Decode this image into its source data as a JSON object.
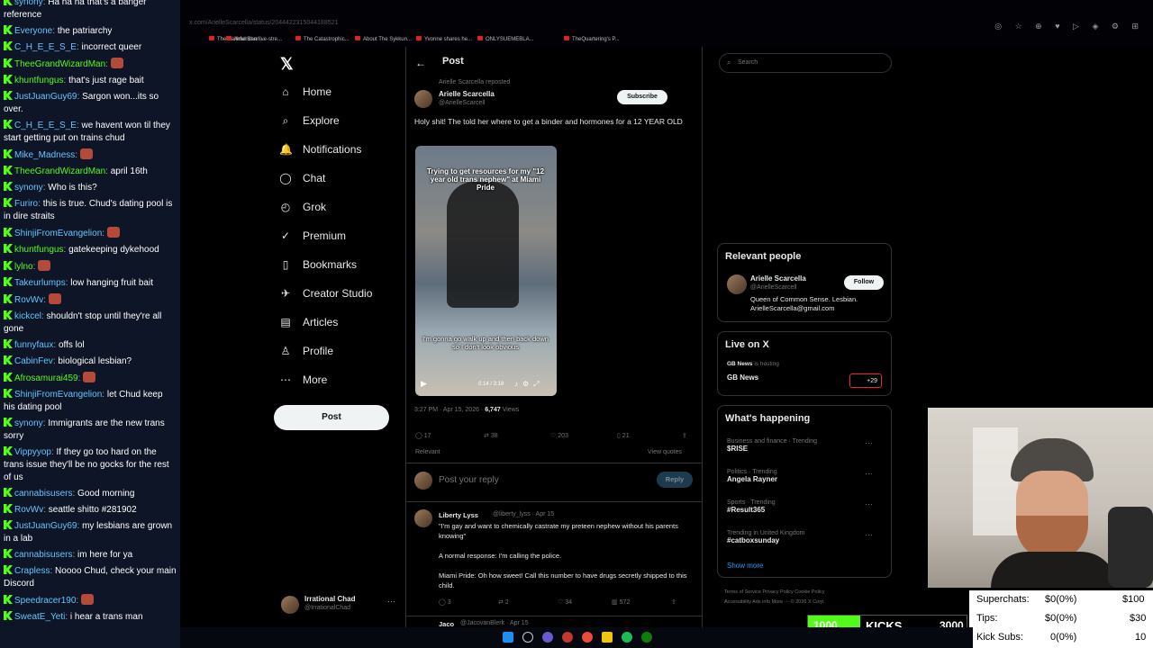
{
  "chat": [
    {
      "user": "synony",
      "text": "Ha ha ha that's a banger reference",
      "c": "c2"
    },
    {
      "user": "Everyone",
      "text": "the patriarchy",
      "c": "c2"
    },
    {
      "user": "C_H_E_E_S_E",
      "text": "incorrect queer",
      "c": "c2"
    },
    {
      "user": "TheeGrandWizardMan",
      "text": "",
      "c": "",
      "emote": true
    },
    {
      "user": "khuntfungus",
      "text": "that's just rage bait",
      "c": ""
    },
    {
      "user": "JustJuanGuy69",
      "text": "Sargon won...its so over.",
      "c": "c2"
    },
    {
      "user": "C_H_E_E_S_E",
      "text": "we havent won til they start getting put on trains chud",
      "c": "c2"
    },
    {
      "user": "Mike_Madness",
      "text": "",
      "c": "c2",
      "emote": true
    },
    {
      "user": "TheeGrandWizardMan",
      "text": "april 16th",
      "c": ""
    },
    {
      "user": "synony",
      "text": "Who is this?",
      "c": "c2"
    },
    {
      "user": "Furiro",
      "text": "this is true. Chud's dating pool is in dire straits",
      "c": "c2"
    },
    {
      "user": "ShinjiFromEvangelion",
      "text": "",
      "c": "c2",
      "emote": true
    },
    {
      "user": "khuntfungus",
      "text": "gatekeeping dykehood",
      "c": ""
    },
    {
      "user": "lylno",
      "text": "",
      "c": "",
      "emote": true
    },
    {
      "user": "Takeurlumps",
      "text": "low hanging fruit bait",
      "c": "c2"
    },
    {
      "user": "RovWv",
      "text": "",
      "c": "c2",
      "emote": true
    },
    {
      "user": "kickcel",
      "text": "shouldn't stop until they're all gone",
      "c": "c2"
    },
    {
      "user": "funnyfaux",
      "text": "offs lol",
      "c": "c2"
    },
    {
      "user": "CabinFev",
      "text": "biological lesbian?",
      "c": "c2"
    },
    {
      "user": "Afrosamurai459",
      "text": "",
      "c": "",
      "emote": true
    },
    {
      "user": "ShinjiFromEvangelion",
      "text": "let Chud keep his dating pool",
      "c": "c2"
    },
    {
      "user": "synony",
      "text": "Immigrants are the new trans sorry",
      "c": "c2"
    },
    {
      "user": "Vippyyop",
      "text": "If they go too hard on the trans issue they'll be no gocks for the rest of us",
      "c": "c2"
    },
    {
      "user": "cannabisusers",
      "text": "Good morning",
      "c": "c2"
    },
    {
      "user": "RovWv",
      "text": "seattle shitto #281902",
      "c": "c2"
    },
    {
      "user": "JustJuanGuy69",
      "text": "my lesbians are grown in a lab",
      "c": "c2"
    },
    {
      "user": "cannabisusers",
      "text": "im here for ya",
      "c": "c2"
    },
    {
      "user": "Crapless",
      "text": "Noooo Chud, check your main Discord",
      "c": "c2"
    },
    {
      "user": "Speedracer190",
      "text": "",
      "c": "c2",
      "emote": true
    },
    {
      "user": "SweatE_Yeti",
      "text": "i hear a trans man",
      "c": "c2"
    }
  ],
  "browser": {
    "url": "x.com/ArielleScarcella/status/2044422315044188521",
    "bookmarks": [
      "The Faithful Sheri...",
      "American live-stre...",
      "The Catastrophic...",
      "About The Sykkun...",
      "Yvonne shares he...",
      "ONLYSUEMEBLA...",
      "TheQuartering's P..."
    ]
  },
  "nav": [
    {
      "icon": "home-icon",
      "glyph": "⌂",
      "label": "Home"
    },
    {
      "icon": "explore-icon",
      "glyph": "⌕",
      "label": "Explore"
    },
    {
      "icon": "bell-icon",
      "glyph": "🔔",
      "label": "Notifications"
    },
    {
      "icon": "chat-icon",
      "glyph": "◯",
      "label": "Chat"
    },
    {
      "icon": "grok-icon",
      "glyph": "◴",
      "label": "Grok"
    },
    {
      "icon": "premium-icon",
      "glyph": "✓",
      "label": "Premium"
    },
    {
      "icon": "bookmark-icon",
      "glyph": "▯",
      "label": "Bookmarks"
    },
    {
      "icon": "creator-icon",
      "glyph": "✈",
      "label": "Creator Studio"
    },
    {
      "icon": "articles-icon",
      "glyph": "▤",
      "label": "Articles"
    },
    {
      "icon": "profile-icon",
      "glyph": "♙",
      "label": "Profile"
    },
    {
      "icon": "more-icon",
      "glyph": "⋯",
      "label": "More"
    }
  ],
  "post_button": "Post",
  "account": {
    "name": "Irrational Chad",
    "handle": "@IrrationalChad"
  },
  "main": {
    "header": "Post",
    "reposted": "Arielle Scarcella reposted",
    "author": "Arielle Scarcella",
    "handle": "@ArielleScarcell",
    "subscribe": "Subscribe",
    "text": "Holy shit! The told her where to get a binder and hormones for a 12 YEAR OLD",
    "video_caption_top": "Trying to get resources for my \"12 year old trans nephew\" at Miami Pride",
    "video_caption_bottom": "I'm gonna go walk up and then back down so I don't look obvious",
    "video_time": "0:14 / 3:18",
    "timestamp": "3:27 PM · Apr 15, 2026 ·",
    "views_count": "6,747",
    "views_label": "Views",
    "stats": {
      "replies": "17",
      "reposts": "38",
      "likes": "203",
      "bookmarks": "21"
    },
    "relevant": "Relevant",
    "view_quotes": "View quotes",
    "reply_placeholder": "Post your reply",
    "reply_btn": "Reply",
    "reply": {
      "author": "Liberty Lyss",
      "handle": "@liberty_lyss · Apr 15",
      "line1": "\"I'm gay and want to chemically castrate my preteen nephew without his parents knowing\"",
      "line2": "A normal response: I'm calling the police.",
      "line3": "Miami Pride: Oh how sweet! Call this number to have drugs secretly shipped to this child.",
      "stats": {
        "replies": "3",
        "reposts": "2",
        "likes": "34",
        "views": "572"
      }
    },
    "next_author": "Jaco",
    "next_handle": "@JacovanBlerk · Apr 15"
  },
  "right": {
    "search_placeholder": "Search",
    "relevant_title": "Relevant people",
    "person_name": "Arielle Scarcella",
    "person_handle": "@ArielleScarcell",
    "person_bio": "Queen of Common Sense. Lesbian. ArielleScarcella@gmail.com",
    "follow": "Follow",
    "live_title": "Live on X",
    "live_host": "GB News",
    "live_host_suffix": "is hosting",
    "live_name": "GB News",
    "live_count": "+29",
    "happening_title": "What's happening",
    "trends": [
      {
        "cat": "Business and finance · Trending",
        "name": "$RISE"
      },
      {
        "cat": "Politics · Trending",
        "name": "Angela Rayner"
      },
      {
        "cat": "Sports · Trending",
        "name": "#Result365"
      },
      {
        "cat": "Trending in United Kingdom",
        "name": "#catboxsunday"
      }
    ],
    "show_more": "Show more",
    "footer": "Terms of Service   Privacy Policy   Cookie Policy   Accessibility   Ads info   More ···   © 2026 X Corp."
  },
  "overlay": {
    "superchats_label": "Superchats:",
    "superchats_val": "$0(0%)",
    "superchats_goal": "$100",
    "tips_label": "Tips:",
    "tips_val": "$0(0%)",
    "tips_goal": "$30",
    "kicksubs_label": "Kick Subs:",
    "kicksubs_val": "0(0%)",
    "kicksubs_goal": "10",
    "kicks_left": "1000",
    "kicks_label": "KICKS",
    "kicks_right": "3000",
    "kicks_progress": 0.33
  },
  "colors": {
    "kick_green": "#53fc18",
    "x_blue": "#1d9bf0",
    "chat_bg": "#0e1526"
  }
}
